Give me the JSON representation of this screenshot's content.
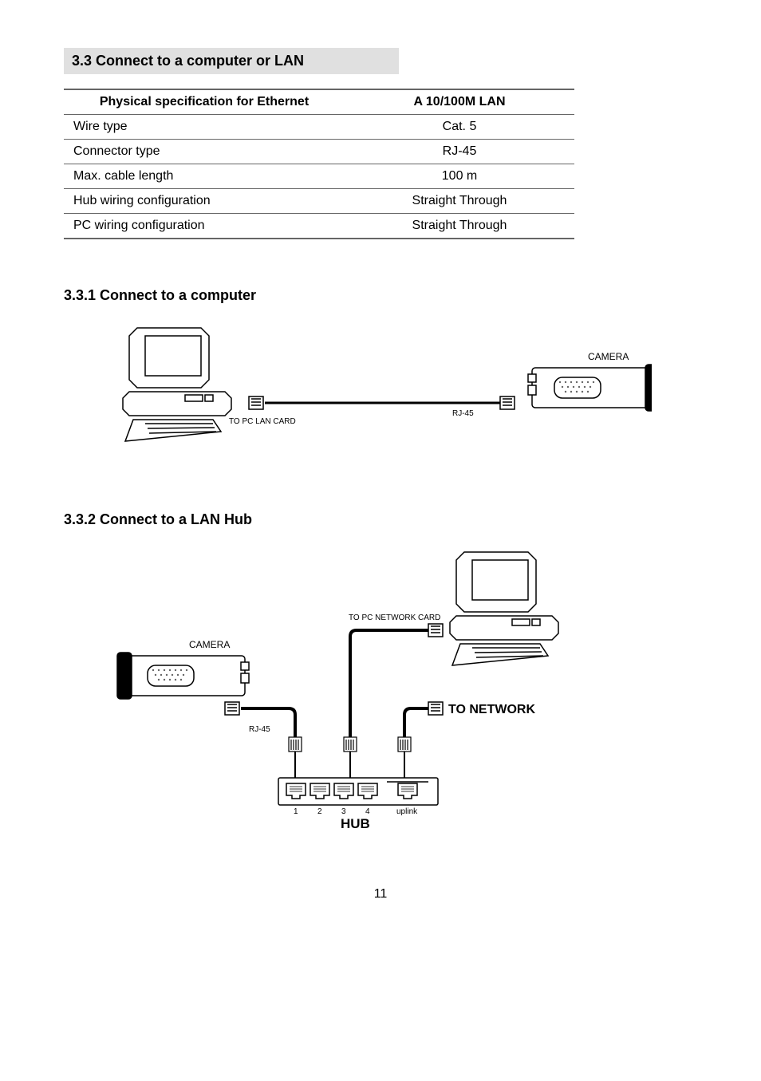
{
  "section_title": "3.3 Connect to a computer or LAN",
  "table": {
    "headers": [
      "Physical specification for Ethernet",
      "A 10/100M LAN"
    ],
    "rows": [
      [
        "Wire type",
        "Cat. 5"
      ],
      [
        "Connector type",
        "RJ-45"
      ],
      [
        "Max. cable length",
        "100 m"
      ],
      [
        "Hub wiring configuration",
        "Straight Through"
      ],
      [
        "PC wiring configuration",
        "Straight Through"
      ]
    ]
  },
  "diagram1": {
    "heading": "3.3.1 Connect to a computer",
    "camera_label": "CAMERA",
    "rj45_label": "RJ-45",
    "pc_lan_label": "TO PC LAN CARD"
  },
  "diagram2": {
    "heading": "3.3.2 Connect to a LAN Hub",
    "camera_label": "CAMERA",
    "rj45_label": "RJ-45",
    "pc_net_label": "TO PC NETWORK CARD",
    "to_network_label": "TO NETWORK",
    "hub_label": "HUB",
    "port_labels": [
      "1",
      "2",
      "3",
      "4",
      "uplink"
    ]
  },
  "page_number": "11"
}
